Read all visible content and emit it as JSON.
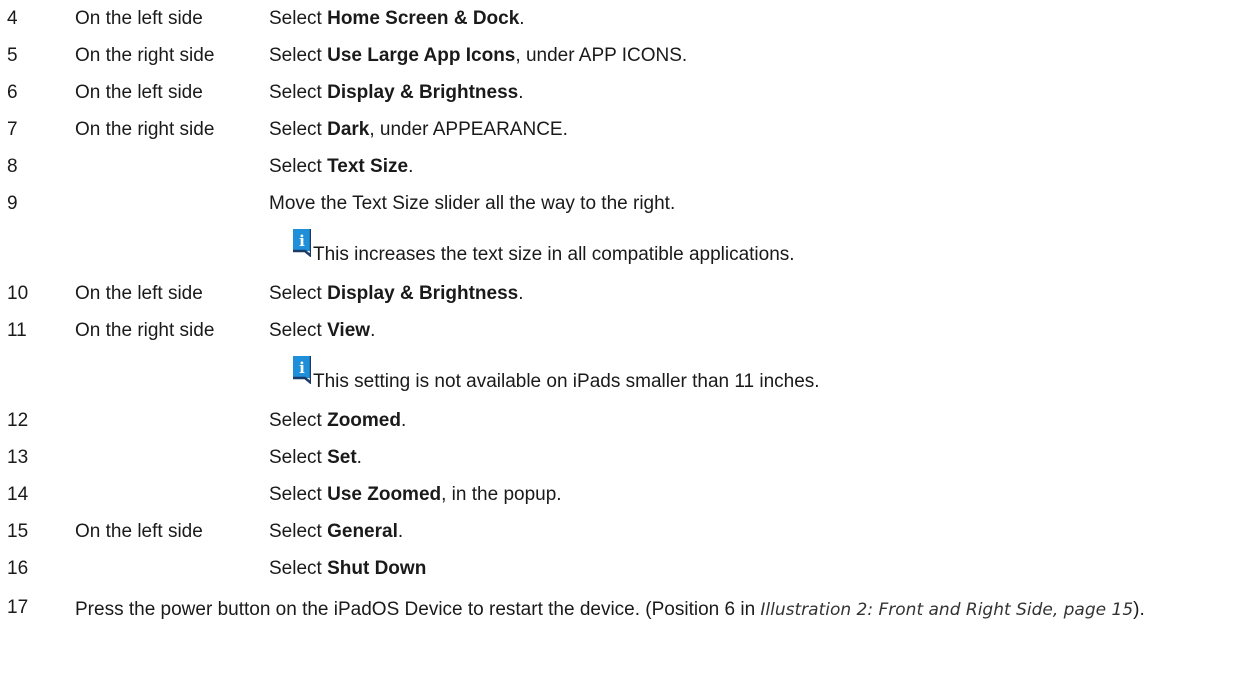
{
  "steps": [
    {
      "num": "4",
      "side": "On the left side",
      "pre": "Select ",
      "bold": "Home Screen & Dock",
      "post": "."
    },
    {
      "num": "5",
      "side": "On the right side",
      "pre": "Select ",
      "bold": "Use Large App Icons",
      "post": ", under APP ICONS."
    },
    {
      "num": "6",
      "side": "On the left side",
      "pre": "Select ",
      "bold": "Display & Brightness",
      "post": "."
    },
    {
      "num": "7",
      "side": "On the right side",
      "pre": "Select ",
      "bold": "Dark",
      "post": ", under APPEARANCE."
    },
    {
      "num": "8",
      "side": "",
      "pre": "Select ",
      "bold": "Text Size",
      "post": "."
    },
    {
      "num": "9",
      "side": "",
      "pre": "Move the Text Size slider all the way to the right.",
      "bold": "",
      "post": ""
    },
    {
      "num": "10",
      "side": "On the left side",
      "pre": "Select ",
      "bold": "Display & Brightness",
      "post": "."
    },
    {
      "num": "11",
      "side": "On the right side",
      "pre": "Select ",
      "bold": "View",
      "post": "."
    },
    {
      "num": "12",
      "side": "",
      "pre": "Select ",
      "bold": "Zoomed",
      "post": "."
    },
    {
      "num": "13",
      "side": "",
      "pre": "Select ",
      "bold": "Set",
      "post": "."
    },
    {
      "num": "14",
      "side": "",
      "pre": "Select ",
      "bold": "Use Zoomed",
      "post": ", in the popup."
    },
    {
      "num": "15",
      "side": "On the left side",
      "pre": "Select ",
      "bold": "General",
      "post": "."
    },
    {
      "num": "16",
      "side": "",
      "pre": "Select ",
      "bold": "Shut Down",
      "post": ""
    }
  ],
  "notes": [
    {
      "icon": "info-icon",
      "text": "This increases the text size in all compatible applications."
    },
    {
      "icon": "info-icon",
      "text": "This setting is not available on iPads smaller than 11 inches."
    }
  ],
  "step17": {
    "num": "17",
    "text_before": "Press the power button on the iPadOS Device to restart the device. (Position 6 in ",
    "cite": "Illustration 2: Front and Right Side, page 15",
    "text_after": ")."
  },
  "colors": {
    "text": "#1a1a1a",
    "info_icon": "#1e8fd8",
    "info_icon_border": "#1b3a66"
  }
}
